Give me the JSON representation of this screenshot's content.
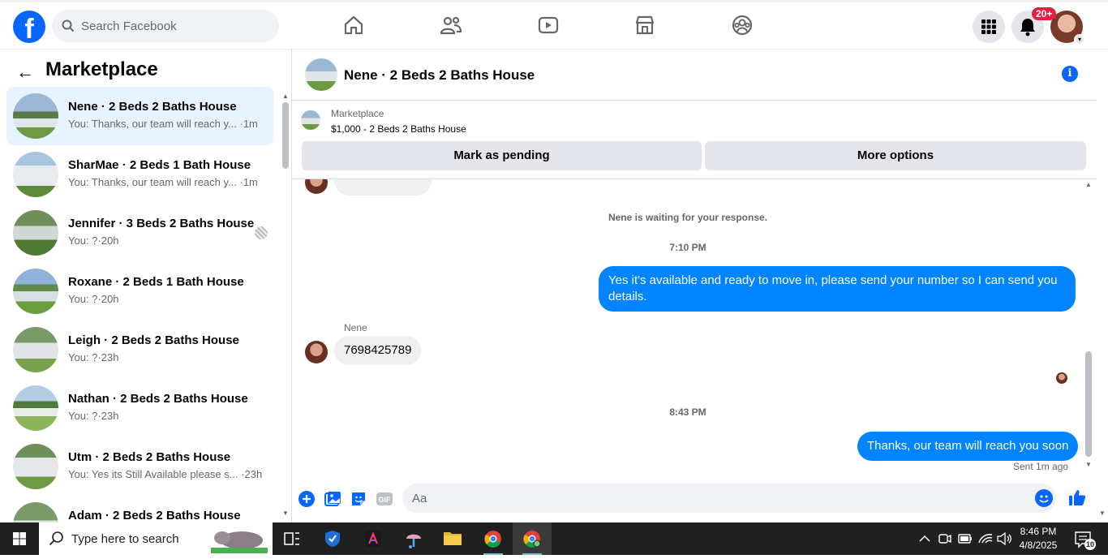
{
  "topbar": {
    "logo": "f",
    "search_placeholder": "Search Facebook",
    "notifications_badge": "20+",
    "nav": [
      "home-icon",
      "friends-icon",
      "watch-icon",
      "marketplace-icon",
      "groups-icon"
    ]
  },
  "sidebar": {
    "title": "Marketplace",
    "conversations": [
      {
        "name": "Nene · 2 Beds 2 Baths House",
        "preview": "You: Thanks, our team will reach y...",
        "time": "·1m",
        "active": true
      },
      {
        "name": "SharMae · 2 Beds 1 Bath House",
        "preview": "You: Thanks, our team will reach y...",
        "time": "·1m"
      },
      {
        "name": "Jennifer · 3 Beds 2 Baths House",
        "preview": "You: ?",
        "time": "·20h"
      },
      {
        "name": "Roxane · 2 Beds 1 Bath House",
        "preview": "You: ?",
        "time": "·20h"
      },
      {
        "name": "Leigh · 2 Beds 2 Baths House",
        "preview": "You: ?",
        "time": "·23h"
      },
      {
        "name": "Nathan · 2 Beds 2 Baths House",
        "preview": "You: ?",
        "time": "·23h"
      },
      {
        "name": "Utm · 2 Beds 2 Baths House",
        "preview": "You: Yes its Still Available please s...",
        "time": "·23h"
      },
      {
        "name": "Adam · 2 Beds 2 Baths House",
        "preview": "",
        "time": ""
      }
    ]
  },
  "chat": {
    "title": "Nene · 2 Beds 2 Baths House",
    "listing_category": "Marketplace",
    "listing_title": "$1,000 - 2 Beds 2 Baths House",
    "mark_pending_label": "Mark as pending",
    "more_options_label": "More options",
    "waiting_notice": "Nene is waiting for your response.",
    "timestamp_1": "7:10 PM",
    "outgoing_1": "Yes it's available and ready to move in, please send your number so I can send you details.",
    "incoming_sender": "Nene",
    "incoming_1": "7698425789",
    "timestamp_2": "8:43 PM",
    "outgoing_2": "Thanks, our team will reach you soon",
    "sent_status": "Sent 1m ago",
    "composer_placeholder": "Aa"
  },
  "taskbar": {
    "search_placeholder": "Type here to search",
    "time": "8:46 PM",
    "date": "4/8/2025",
    "notification_count": "10"
  },
  "colors": {
    "brand": "#0866ff",
    "outgoing_bubble": "#0084ff",
    "incoming_bubble": "#f0f0f0",
    "active_row": "#e7f3ff",
    "badge": "#e41e3f"
  }
}
